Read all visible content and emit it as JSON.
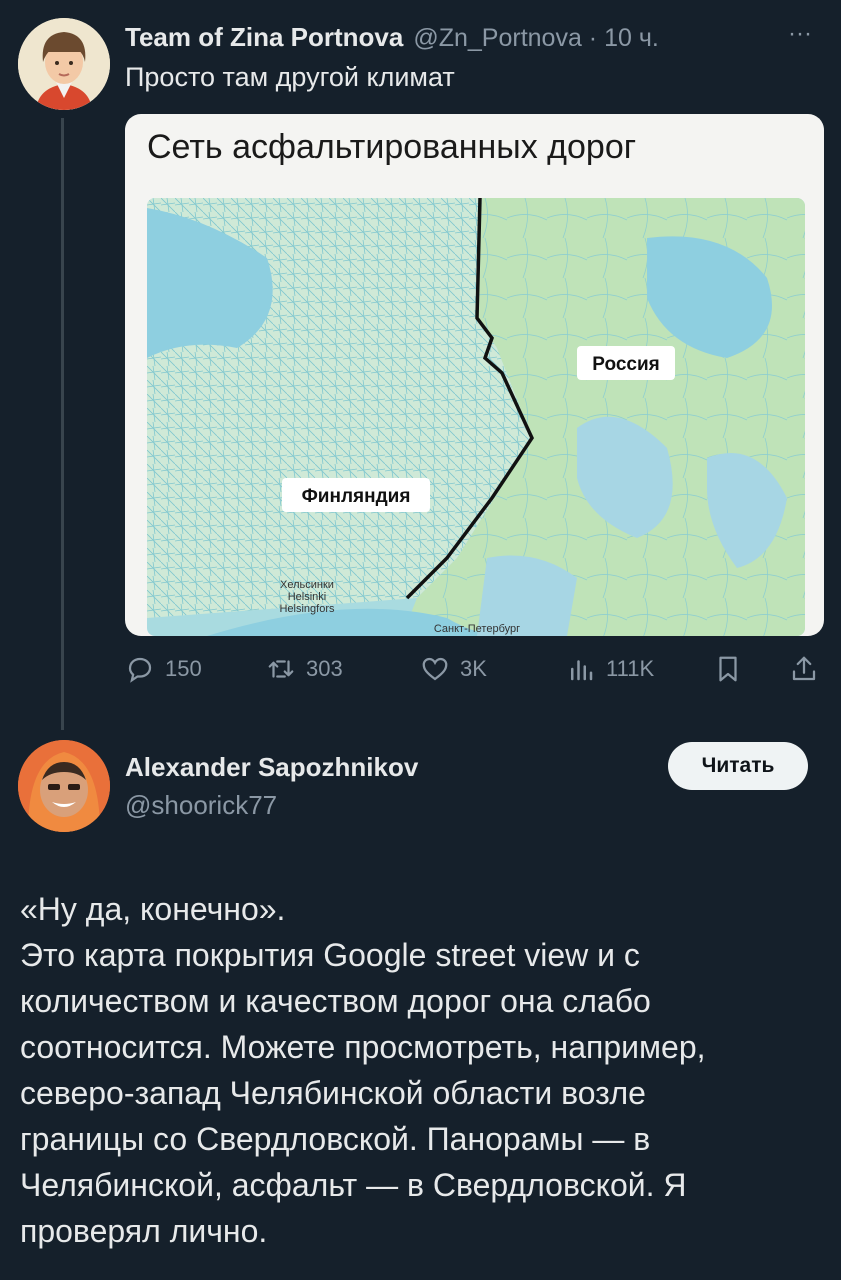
{
  "tweet": {
    "author_name": "Team of Zina Portnova",
    "handle_time": "@Zn_Portnova · 10 ч.",
    "more": "···",
    "text": "Просто там другой климат",
    "card": {
      "title": "Сеть асфальтированных дорог",
      "label_russia": "Россия",
      "label_finland": "Финляндия",
      "label_helsinki_1": "Хельсинки",
      "label_helsinki_2": "Helsinki",
      "label_helsinki_3": "Helsingfors",
      "label_spb": "Санкт-Петербург"
    },
    "stats": {
      "replies": "150",
      "reposts": "303",
      "likes": "3K",
      "views": "111K"
    }
  },
  "reply": {
    "author_name": "Alexander Sapozhnikov",
    "handle": "@shoorick77",
    "follow_label": "Читать",
    "lines": [
      "«Ну да, конечно».",
      "Это карта покрытия Google street view и с",
      "количеством и качеством дорог она слабо",
      "соотносится. Можете просмотреть, например,",
      "северо-запад Челябинской области возле",
      "границы со Свердловской. Панорамы — в",
      "Челябинской, асфальт — в Свердловской. Я",
      "проверял лично."
    ]
  },
  "colors": {
    "background": "#15202b",
    "text": "#e7e9ea",
    "muted": "#8b98a5",
    "button_bg": "#eff3f4"
  }
}
